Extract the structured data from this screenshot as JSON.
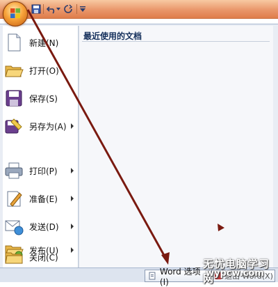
{
  "menu": {
    "items": [
      {
        "label": "新建(N)",
        "icon": "new-document-icon",
        "has_submenu": false
      },
      {
        "label": "打开(O)",
        "icon": "open-folder-icon",
        "has_submenu": false
      },
      {
        "label": "保存(S)",
        "icon": "save-disk-icon",
        "has_submenu": false
      },
      {
        "label": "另存为(A)",
        "icon": "save-as-icon",
        "has_submenu": true
      },
      {
        "label": "打印(P)",
        "icon": "printer-icon",
        "has_submenu": true
      },
      {
        "label": "准备(E)",
        "icon": "prepare-pen-icon",
        "has_submenu": true
      },
      {
        "label": "发送(D)",
        "icon": "send-icon",
        "has_submenu": true
      },
      {
        "label": "发布(U)",
        "icon": "publish-folder-icon",
        "has_submenu": true
      },
      {
        "label": "关闭(C)",
        "icon": "close-folder-icon",
        "has_submenu": false
      }
    ]
  },
  "recent": {
    "title": "最近使用的文档"
  },
  "footer": {
    "options_label": "Word 选项(I)",
    "exit_label": "退出 Word(X)"
  },
  "watermark": {
    "line1": "无忧电脑学习网",
    "line2": "wypcw.com"
  },
  "colors": {
    "accent": "#7a1a10",
    "qat": "#e9966a",
    "menu_bg": "#e9edf4"
  }
}
